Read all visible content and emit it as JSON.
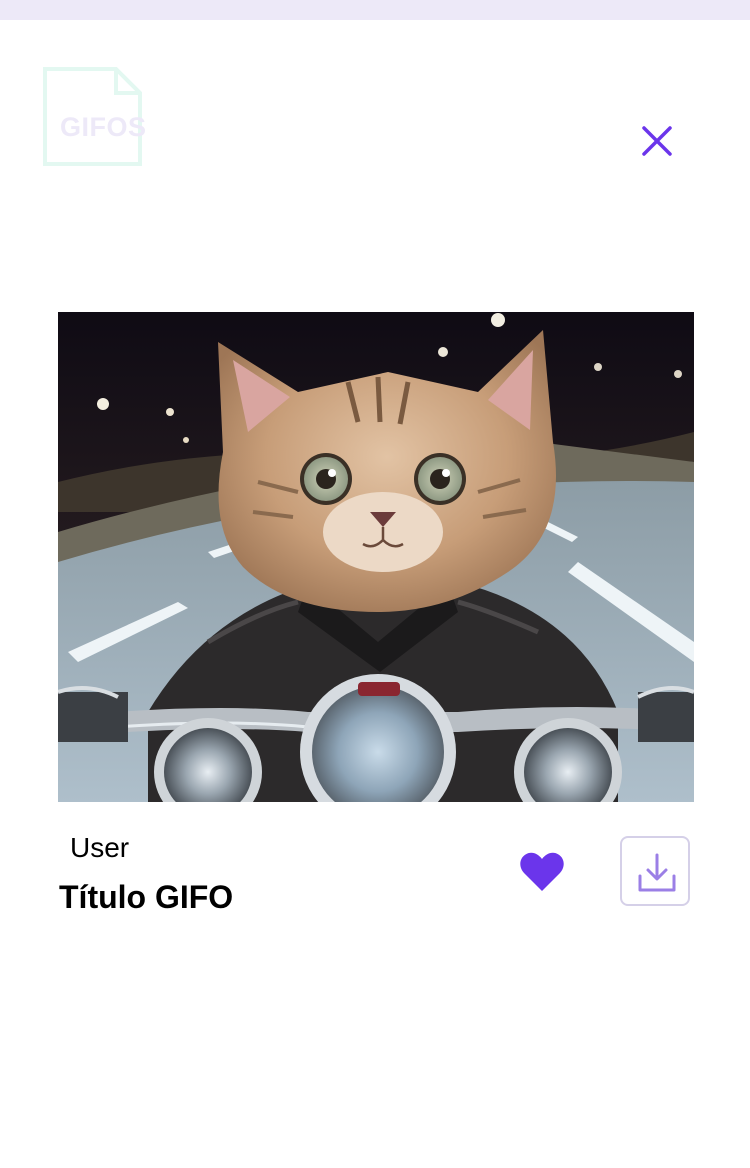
{
  "logo": {
    "text": "GIFOS",
    "icon": "gifos-logo-icon",
    "color": "#EDE9F8",
    "outline_color": "#E3F8F1"
  },
  "header": {
    "close_icon": "close-icon"
  },
  "gif": {
    "image": "cat-biker-gif"
  },
  "details": {
    "user": "User",
    "title": "Título GIFO"
  },
  "actions": {
    "favorite_icon": "heart-icon",
    "download_icon": "download-icon"
  },
  "colors": {
    "accent": "#6B35EB",
    "top_strip": "#EDE9F8",
    "download_border": "#D5D0E8",
    "download_icon": "#9B7FE6"
  }
}
